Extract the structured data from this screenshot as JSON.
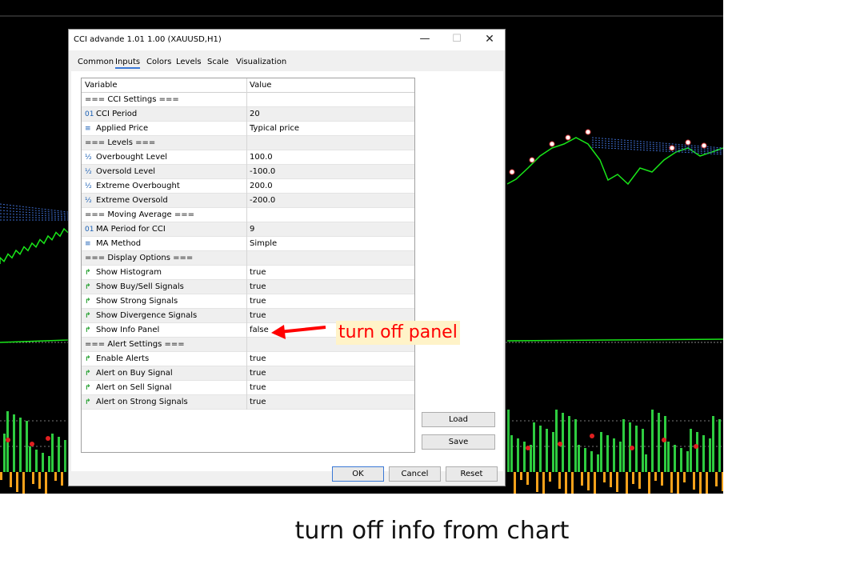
{
  "caption": "turn off info from chart",
  "annotation": "turn off panel",
  "dialog": {
    "title": "CCI advande 1.01 1.00 (XAUUSD,H1)",
    "minimize": "—",
    "maximize": "☐",
    "close": "✕",
    "tabs": [
      {
        "label": "Common"
      },
      {
        "label": "Inputs",
        "active": true
      },
      {
        "label": "Colors"
      },
      {
        "label": "Levels"
      },
      {
        "label": "Scale"
      },
      {
        "label": "Visualization"
      }
    ],
    "columns": {
      "variable": "Variable",
      "value": "Value"
    },
    "rows": [
      {
        "icon": "",
        "name": "=== CCI Settings ===",
        "value": ""
      },
      {
        "icon": "int",
        "name": "CCI Period",
        "value": "20"
      },
      {
        "icon": "enum",
        "name": "Applied Price",
        "value": "Typical price"
      },
      {
        "icon": "",
        "name": "=== Levels ===",
        "value": ""
      },
      {
        "icon": "double",
        "name": "Overbought Level",
        "value": "100.0"
      },
      {
        "icon": "double",
        "name": "Oversold Level",
        "value": "-100.0"
      },
      {
        "icon": "double",
        "name": "Extreme Overbought",
        "value": "200.0"
      },
      {
        "icon": "double",
        "name": "Extreme Oversold",
        "value": "-200.0"
      },
      {
        "icon": "",
        "name": "=== Moving Average ===",
        "value": ""
      },
      {
        "icon": "int",
        "name": "MA Period for CCI",
        "value": "9"
      },
      {
        "icon": "enum",
        "name": "MA Method",
        "value": "Simple"
      },
      {
        "icon": "",
        "name": "=== Display Options ===",
        "value": ""
      },
      {
        "icon": "bool",
        "name": "Show Histogram",
        "value": "true"
      },
      {
        "icon": "bool",
        "name": "Show Buy/Sell Signals",
        "value": "true"
      },
      {
        "icon": "bool",
        "name": "Show Strong Signals",
        "value": "true"
      },
      {
        "icon": "bool",
        "name": "Show Divergence Signals",
        "value": "true"
      },
      {
        "icon": "bool",
        "name": "Show Info Panel",
        "value": "false"
      },
      {
        "icon": "",
        "name": "=== Alert Settings ===",
        "value": ""
      },
      {
        "icon": "bool",
        "name": "Enable Alerts",
        "value": "true"
      },
      {
        "icon": "bool",
        "name": "Alert on Buy Signal",
        "value": "true"
      },
      {
        "icon": "bool",
        "name": "Alert on Sell Signal",
        "value": "true"
      },
      {
        "icon": "bool",
        "name": "Alert on Strong Signals",
        "value": "true"
      }
    ],
    "buttons": {
      "load": "Load",
      "save": "Save",
      "ok": "OK",
      "cancel": "Cancel",
      "reset": "Reset"
    }
  },
  "icons": {
    "int": "01",
    "enum": "≡",
    "double": "½",
    "bool": "↱"
  },
  "colors": {
    "price_line": "#19e619",
    "histogram_up": "#2ecc40",
    "histogram_down": "#f7a21b",
    "signal_sell": "#e02020",
    "annotation": "#ff0000"
  }
}
